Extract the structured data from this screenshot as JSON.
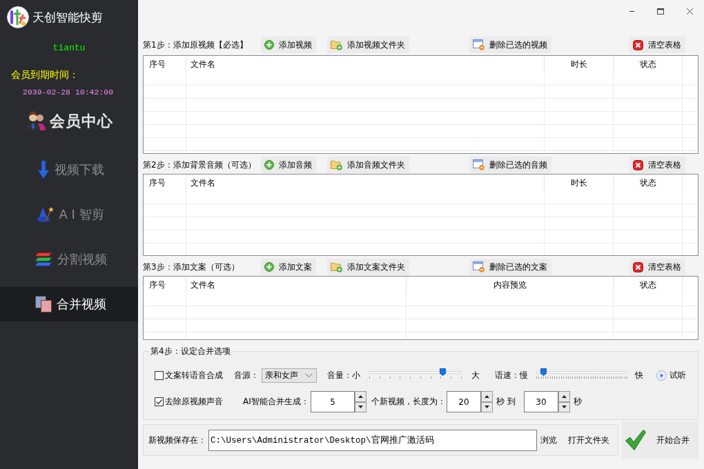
{
  "sidebar": {
    "app_title": "天创智能快剪",
    "username": "tiantu",
    "expiry_label": "会员到期时间：",
    "expiry_time": "2039-02-28 10:42:00",
    "member_center": "会员中心",
    "nav_items": [
      {
        "label": "视频下载",
        "selected": false
      },
      {
        "label": "A I 智剪",
        "selected": false
      },
      {
        "label": "分割视频",
        "selected": false
      },
      {
        "label": "合并视频",
        "selected": true
      }
    ]
  },
  "steps": [
    {
      "title": "第1步：添加原视频【必选】",
      "buttons": [
        {
          "label": "添加视频",
          "kind": "add"
        },
        {
          "label": "添加视频文件夹",
          "kind": "add_folder"
        },
        {
          "label": "删除已选的视频",
          "kind": "delete"
        },
        {
          "label": "清空表格",
          "kind": "clear"
        }
      ],
      "table": {
        "columns": [
          "序号",
          "文件名",
          "时长",
          "状态"
        ]
      }
    },
    {
      "title": "第2步：添加背景音频（可选）",
      "buttons": [
        {
          "label": "添加音频",
          "kind": "add"
        },
        {
          "label": "添加音频文件夹",
          "kind": "add_folder"
        },
        {
          "label": "删除已选的音频",
          "kind": "delete"
        },
        {
          "label": "清空表格",
          "kind": "clear"
        }
      ],
      "table": {
        "columns": [
          "序号",
          "文件名",
          "时长",
          "状态"
        ]
      }
    },
    {
      "title": "第3步：添加文案（可选）",
      "buttons": [
        {
          "label": "添加文案",
          "kind": "add"
        },
        {
          "label": "添加文案文件夹",
          "kind": "add_folder"
        },
        {
          "label": "删除已选的文案",
          "kind": "delete"
        },
        {
          "label": "清空表格",
          "kind": "clear"
        }
      ],
      "table": {
        "columns": [
          "序号",
          "文件名",
          "内容预览",
          "状态"
        ]
      }
    }
  ],
  "merge_options": {
    "title": "第4步：设定合并选项",
    "tts": {
      "label": "文案转语音合成",
      "checked": false
    },
    "voice": {
      "label": "音源：",
      "value": "亲和女声"
    },
    "volume": {
      "label": "音量：",
      "min_label": "小",
      "max_label": "大",
      "level": 0.8
    },
    "speed": {
      "label": "语速：",
      "min_label": "慢",
      "max_label": "快",
      "level": 0.08
    },
    "preview_button": "试听",
    "mute_original": {
      "label": "去除原视频声音",
      "checked": true
    },
    "count": {
      "label": "AI智能合并生成：",
      "value": "5"
    },
    "length_label": "个新视频，长度为：",
    "min_length": "20",
    "to_label": "秒 到",
    "max_length": "30",
    "unit": "秒"
  },
  "save": {
    "label": "新视频保存在：",
    "path": "C:\\Users\\Administrator\\Desktop\\官网推广激活码",
    "browse": "浏览",
    "open_folder": "打开文件夹"
  },
  "start_button": "开始合并"
}
